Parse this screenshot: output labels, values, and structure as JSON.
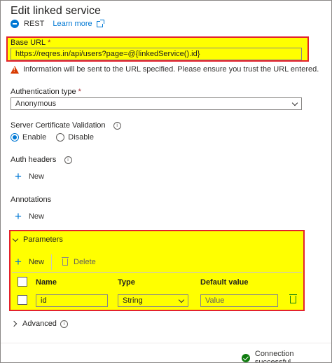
{
  "panel": {
    "title": "Edit linked service",
    "service_type": "REST",
    "learn_more": "Learn more"
  },
  "base_url": {
    "label": "Base URL",
    "required_mark": "*",
    "value": "https://reqres.in/api/users?page=@{linkedService().id}",
    "warning": "Information will be sent to the URL specified. Please ensure you trust the URL entered."
  },
  "auth_type": {
    "label": "Authentication type",
    "required_mark": "*",
    "selected": "Anonymous"
  },
  "cert_validation": {
    "label": "Server Certificate Validation",
    "info_glyph": "i",
    "options": [
      "Enable",
      "Disable"
    ],
    "selected": "Enable"
  },
  "auth_headers": {
    "label": "Auth headers",
    "info_glyph": "i",
    "new_label": "New"
  },
  "annotations": {
    "label": "Annotations",
    "new_label": "New"
  },
  "parameters": {
    "label": "Parameters",
    "new_label": "New",
    "delete_label": "Delete",
    "columns": [
      "Name",
      "Type",
      "Default value"
    ],
    "rows": [
      {
        "name": "id",
        "type": "String",
        "default_placeholder": "Value"
      }
    ]
  },
  "advanced": {
    "label": "Advanced",
    "info_glyph": "i"
  },
  "status": {
    "text": "Connection successful"
  },
  "colors": {
    "highlight": "#ffff00",
    "highlight_border": "#e3222c",
    "accent": "#0078d4",
    "success": "#107c10",
    "warning": "#d83b01"
  }
}
